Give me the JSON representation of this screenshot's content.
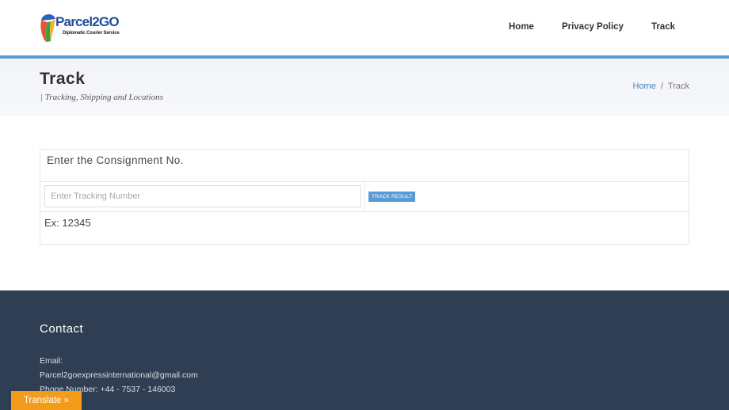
{
  "logo": {
    "name": "Parcel2GO",
    "tagline": "Diplomatic Courier Service"
  },
  "nav": [
    {
      "label": "Home"
    },
    {
      "label": "Privacy Policy"
    },
    {
      "label": "Track"
    }
  ],
  "page": {
    "title": "Track",
    "subtitle": "| Tracking, Shipping and Locations"
  },
  "breadcrumb": {
    "home": "Home",
    "separator": "/",
    "current": "Track"
  },
  "tracking": {
    "heading": "Enter the Consignment No.",
    "placeholder": "Enter Tracking Number",
    "button_label": "TRACK RESULT",
    "example": "Ex: 12345"
  },
  "footer": {
    "title": "Contact",
    "email_label": "Email:",
    "email": "Parcel2goexpressinternational@gmail.com",
    "phone": "Phone Number: +44 - 7537 - 146003"
  },
  "translate": {
    "label": "Translate »"
  },
  "colors": {
    "accent": "#5b9bd5",
    "footer_bg": "#2f3e52",
    "translate_bg": "#f39c1a"
  }
}
